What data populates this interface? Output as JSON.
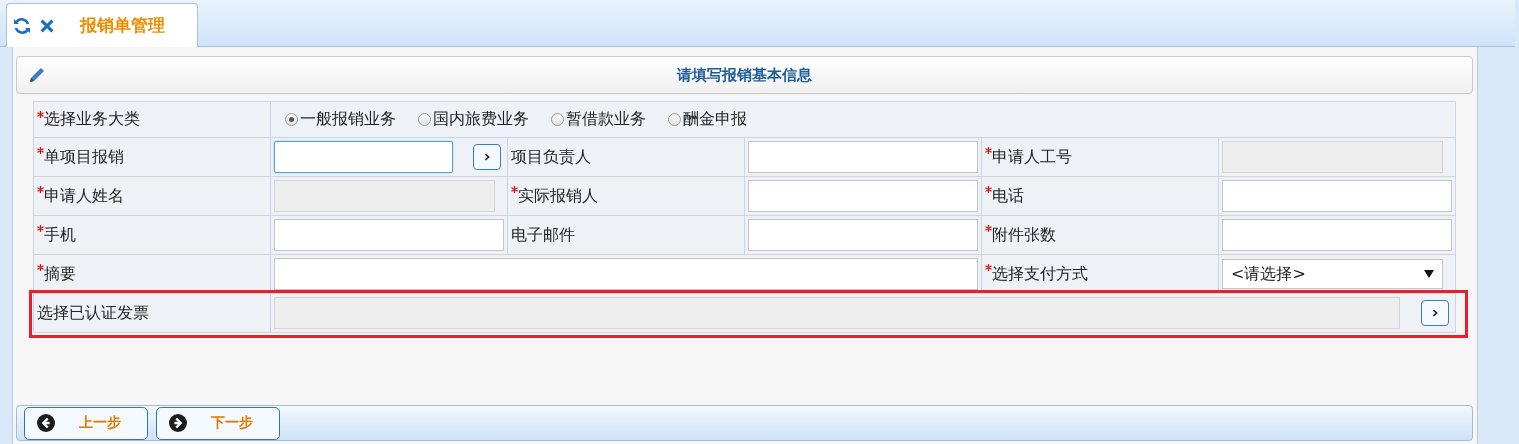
{
  "tab": {
    "title": "报销单管理",
    "selected": true
  },
  "panel": {
    "title": "请填写报销基本信息"
  },
  "business_type": {
    "label": "选择业务大类",
    "required": true,
    "options": [
      {
        "label": "一般报销业务",
        "selected": true
      },
      {
        "label": "国内旅费业务",
        "selected": false
      },
      {
        "label": "暂借款业务",
        "selected": false
      },
      {
        "label": "酬金申报",
        "selected": false
      }
    ]
  },
  "fields": [
    {
      "label": "单项目报销",
      "required": true,
      "kind": "lookup",
      "focused": true,
      "highlighted": false
    },
    {
      "label": "项目负责人",
      "required": false,
      "kind": "input",
      "focused": false,
      "highlighted": false
    },
    {
      "label": "申请人工号",
      "required": true,
      "kind": "readonly",
      "focused": false,
      "highlighted": false
    },
    {
      "label": "申请人姓名",
      "required": true,
      "kind": "readonly",
      "focused": false,
      "highlighted": false
    },
    {
      "label": "实际报销人",
      "required": true,
      "kind": "input",
      "focused": false,
      "highlighted": false
    },
    {
      "label": "电话",
      "required": true,
      "kind": "input",
      "focused": false,
      "highlighted": false
    },
    {
      "label": "手机",
      "required": true,
      "kind": "input",
      "focused": false,
      "highlighted": false
    },
    {
      "label": "电子邮件",
      "required": false,
      "kind": "input",
      "focused": false,
      "highlighted": false
    },
    {
      "label": "附件张数",
      "required": true,
      "kind": "input",
      "focused": false,
      "highlighted": false
    },
    {
      "label": "摘要",
      "required": true,
      "kind": "wide",
      "focused": false,
      "highlighted": false
    },
    {
      "label": "选择支付方式",
      "required": true,
      "kind": "select",
      "value": "<请选择>",
      "focused": false,
      "highlighted": false
    },
    {
      "label": "选择已认证发票",
      "required": false,
      "kind": "invoice",
      "focused": false,
      "highlighted": true
    }
  ],
  "buttons": [
    {
      "label": "上一步",
      "kind": "prev"
    },
    {
      "label": "下一步",
      "kind": "next"
    }
  ]
}
